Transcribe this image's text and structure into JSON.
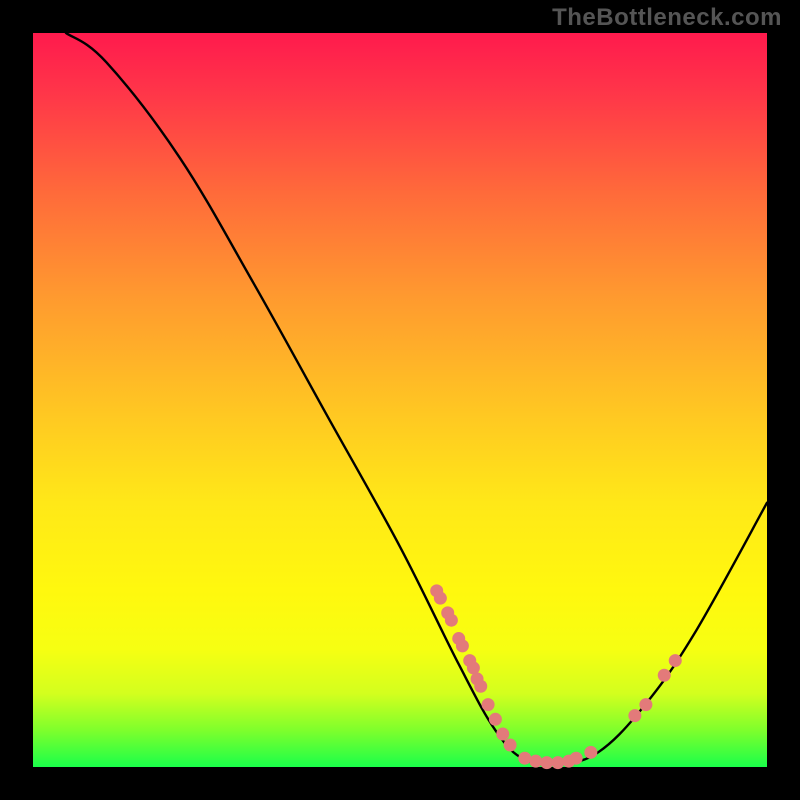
{
  "watermark": "TheBottleneck.com",
  "chart_data": {
    "type": "line",
    "title": "",
    "xlabel": "",
    "ylabel": "",
    "xlim": [
      0,
      100
    ],
    "ylim": [
      0,
      100
    ],
    "curve": [
      {
        "x": 4.5,
        "y": 100
      },
      {
        "x": 10,
        "y": 96
      },
      {
        "x": 20,
        "y": 83
      },
      {
        "x": 30,
        "y": 66
      },
      {
        "x": 40,
        "y": 48
      },
      {
        "x": 50,
        "y": 30
      },
      {
        "x": 58,
        "y": 14
      },
      {
        "x": 63,
        "y": 5
      },
      {
        "x": 67,
        "y": 1
      },
      {
        "x": 72,
        "y": 0.5
      },
      {
        "x": 77,
        "y": 2
      },
      {
        "x": 83,
        "y": 8
      },
      {
        "x": 90,
        "y": 18
      },
      {
        "x": 100,
        "y": 36
      }
    ],
    "markers": [
      {
        "x": 55.5,
        "y": 23
      },
      {
        "x": 56.5,
        "y": 21
      },
      {
        "x": 57.0,
        "y": 20
      },
      {
        "x": 55.0,
        "y": 24
      },
      {
        "x": 58.0,
        "y": 17.5
      },
      {
        "x": 58.5,
        "y": 16.5
      },
      {
        "x": 59.5,
        "y": 14.5
      },
      {
        "x": 60.0,
        "y": 13.5
      },
      {
        "x": 60.5,
        "y": 12
      },
      {
        "x": 61.0,
        "y": 11
      },
      {
        "x": 62.0,
        "y": 8.5
      },
      {
        "x": 63.0,
        "y": 6.5
      },
      {
        "x": 64.0,
        "y": 4.5
      },
      {
        "x": 65.0,
        "y": 3
      },
      {
        "x": 67.0,
        "y": 1.2
      },
      {
        "x": 68.5,
        "y": 0.8
      },
      {
        "x": 70.0,
        "y": 0.6
      },
      {
        "x": 71.5,
        "y": 0.6
      },
      {
        "x": 73.0,
        "y": 0.8
      },
      {
        "x": 74.0,
        "y": 1.2
      },
      {
        "x": 76.0,
        "y": 2.0
      },
      {
        "x": 82.0,
        "y": 7.0
      },
      {
        "x": 83.5,
        "y": 8.5
      },
      {
        "x": 86.0,
        "y": 12.5
      },
      {
        "x": 87.5,
        "y": 14.5
      }
    ],
    "marker_color": "#e37a7a",
    "curve_color": "#000000"
  }
}
